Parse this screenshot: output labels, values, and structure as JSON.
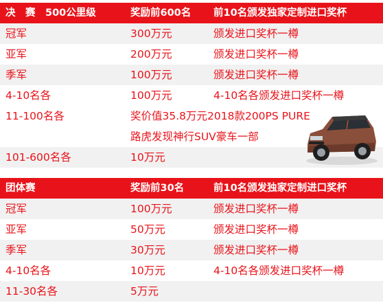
{
  "table1": {
    "header": [
      "决　赛　500公里级",
      "奖励前600名",
      "前10名颁发独家定制进口奖杯"
    ],
    "rows": [
      {
        "rank": "冠军",
        "prize": "300万元",
        "extra": "颁发进口奖杯一樽"
      },
      {
        "rank": "亚军",
        "prize": "200万元",
        "extra": "颁发进口奖杯一樽"
      },
      {
        "rank": "季军",
        "prize": "100万元",
        "extra": "颁发进口奖杯一樽"
      },
      {
        "rank": "4-10名各",
        "prize": "100万元",
        "extra": "4-10名各颁发进口奖杯一樽"
      }
    ],
    "special": {
      "rank": "11-100名各",
      "line1": "奖价值35.8万元2018款200PS PURE",
      "line2": "路虎发现神行SUV豪车一部"
    },
    "last": {
      "rank": "101-600名各",
      "prize": "10万元"
    }
  },
  "table2": {
    "header": [
      "团体赛",
      "奖励前30名",
      "前10名颁发独家定制进口奖杯"
    ],
    "rows": [
      {
        "rank": "冠军",
        "prize": "100万元",
        "extra": "颁发进口奖杯一樽"
      },
      {
        "rank": "亚军",
        "prize": "50万元",
        "extra": "颁发进口奖杯一樽"
      },
      {
        "rank": "季军",
        "prize": "30万元",
        "extra": "颁发进口奖杯一樽"
      },
      {
        "rank": "4-10名各",
        "prize": "10万元",
        "extra": "4-10名各颁发进口奖杯一樽"
      },
      {
        "rank": "11-30名各",
        "prize": "5万元",
        "extra": ""
      }
    ]
  },
  "colors": {
    "accent": "#e8131a",
    "stripe": "#f1f1f1"
  },
  "icons": {
    "car": "suv-car-image"
  }
}
